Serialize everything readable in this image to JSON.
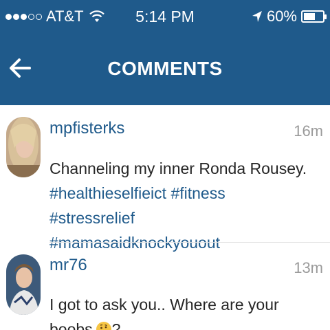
{
  "status_bar": {
    "carrier": "AT&T",
    "time": "5:14 PM",
    "battery": "60%",
    "battery_level": 0.6
  },
  "header": {
    "title": "COMMENTS",
    "back_icon": "arrow-left-icon",
    "background": "#1f5a8b"
  },
  "comments": [
    {
      "username": "mpfisterks",
      "time": "16m",
      "text": "Channeling my inner Ronda Rousey.",
      "hashtags_line1": "#healthieselfieict #fitness #stressrelief",
      "hashtags_line2": "#mamasaidknockyouout"
    },
    {
      "username": "mr76",
      "time": "13m",
      "text": "I got to ask you.. Where are your boobs",
      "suffix": "?",
      "emoji": "thinking-face-icon"
    }
  ],
  "colors": {
    "accent": "#1f5a8b",
    "muted": "#9a9a9a",
    "text": "#262626"
  }
}
